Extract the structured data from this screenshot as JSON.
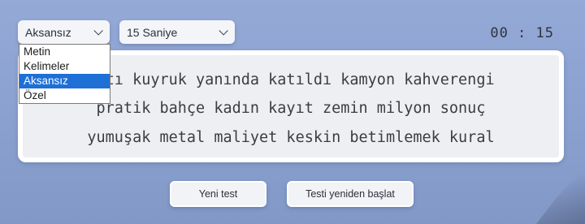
{
  "controls": {
    "mode_select": {
      "value": "Aksansız",
      "options": [
        "Metin",
        "Kelimeler",
        "Aksansız",
        "Özel"
      ],
      "selected_index": 2
    },
    "time_select": {
      "value": "15 Saniye"
    }
  },
  "timer": "00 : 15",
  "text_lines": [
    "patı kuyruk yanında katıldı kamyon kahverengi",
    "pratik bahçe kadın kayıt zemin milyon sonuç",
    "yumuşak metal maliyet keskin betimlemek kural"
  ],
  "buttons": {
    "new_test": "Yeni test",
    "restart": "Testi yeniden başlat"
  },
  "colors": {
    "selected_option_bg": "#1e6fd6",
    "background": "#8aa0cf"
  }
}
